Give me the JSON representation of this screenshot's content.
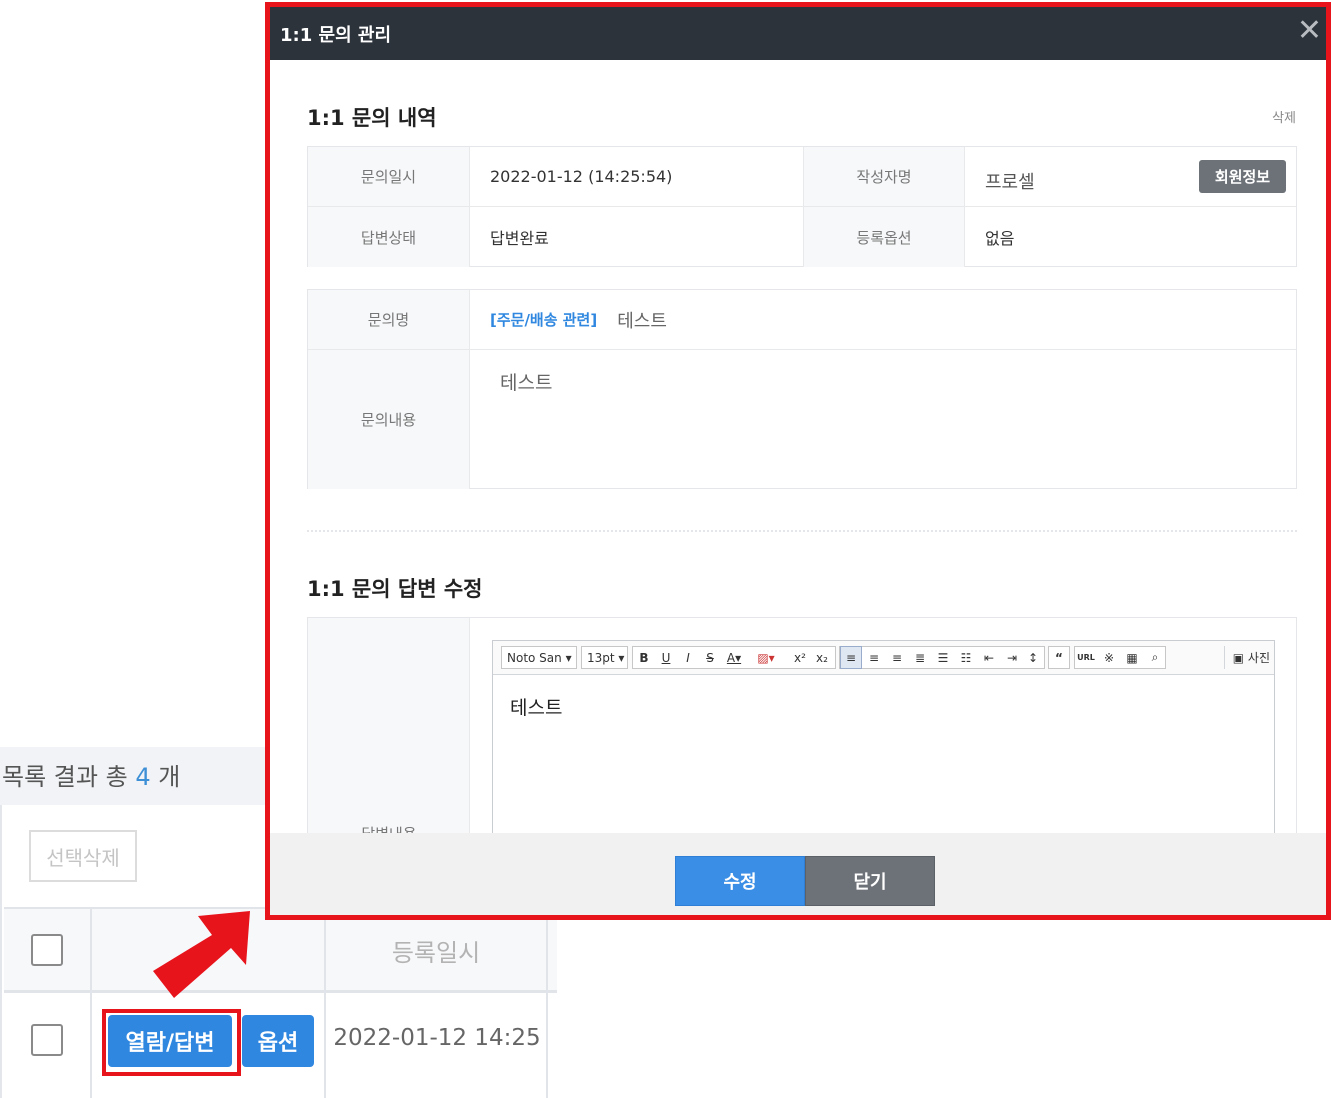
{
  "background": {
    "list_count_prefix": "목록 결과 총",
    "list_count_num": "4",
    "list_count_suffix": "개",
    "select_delete_label": "선택삭제",
    "col_date_header": "등록일시",
    "view_answer_label": "열람/답변",
    "option_label": "옵션",
    "row_date": "2022-01-12 14:25"
  },
  "modal": {
    "title": "1:1 문의 관리",
    "close_icon": "close-icon",
    "section1_title": "1:1 문의 내역",
    "delete_label": "삭제",
    "info": {
      "date_label": "문의일시",
      "date_value": "2022-01-12 (14:25:54)",
      "author_label": "작성자명",
      "author_value": "프로셀",
      "member_info_label": "회원정보",
      "status_label": "답변상태",
      "status_value": "답변완료",
      "option_label": "등록옵션",
      "option_value": "없음"
    },
    "inquiry": {
      "name_label": "문의명",
      "category": "[주문/배송 관련]",
      "subject": "테스트",
      "content_label": "문의내용",
      "content": "테스트"
    },
    "section2_title": "1:1 문의 답변 수정",
    "answer": {
      "label": "답변내용",
      "font_name": "Noto San",
      "font_size": "13pt",
      "photo_label": "사진",
      "content": "테스트"
    },
    "buttons": {
      "edit": "수정",
      "close": "닫기"
    }
  },
  "colors": {
    "highlight": "#e8141c",
    "primary": "#2f87e0",
    "title_bar": "#2c333b"
  }
}
